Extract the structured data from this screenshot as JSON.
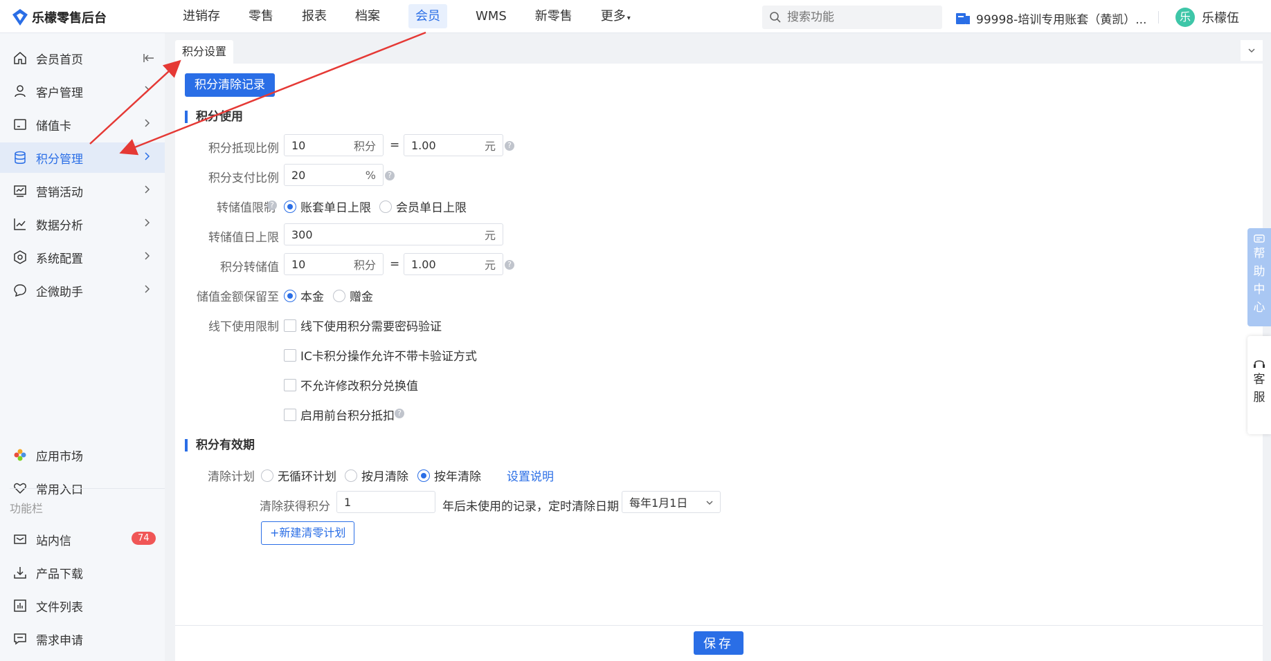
{
  "app": {
    "title": "乐檬零售后台"
  },
  "topnav": {
    "items": [
      "进销存",
      "零售",
      "报表",
      "档案",
      "会员",
      "WMS",
      "新零售",
      "更多"
    ],
    "search_placeholder": "搜索功能",
    "account": "99998-培训专用账套（黄凯）...",
    "user_avatar": "乐",
    "user_name": "乐檬伍"
  },
  "sidebar": {
    "items": [
      {
        "label": "会员首页"
      },
      {
        "label": "客户管理"
      },
      {
        "label": "储值卡"
      },
      {
        "label": "积分管理"
      },
      {
        "label": "营销活动"
      },
      {
        "label": "数据分析"
      },
      {
        "label": "系统配置"
      },
      {
        "label": "企微助手"
      }
    ],
    "extra": [
      {
        "label": "应用市场"
      },
      {
        "label": "常用入口"
      }
    ],
    "group_title": "功能栏",
    "tools": [
      {
        "label": "站内信",
        "badge": "74"
      },
      {
        "label": "产品下载"
      },
      {
        "label": "文件列表"
      },
      {
        "label": "需求申请"
      }
    ]
  },
  "tab": {
    "label": "积分设置"
  },
  "main": {
    "clear_record_btn": "积分清除记录",
    "section_use": "积分使用",
    "rows": {
      "cash_ratio": {
        "label": "积分抵现比例",
        "points": "10",
        "points_unit": "积分",
        "eq": "=",
        "yuan": "1.00",
        "yuan_unit": "元"
      },
      "pay_ratio": {
        "label": "积分支付比例",
        "value": "20",
        "unit": "%"
      },
      "transfer_limit": {
        "label": "转储值限制",
        "opt1": "账套单日上限",
        "opt2": "会员单日上限"
      },
      "daily_limit": {
        "label": "转储值日上限",
        "value": "300",
        "unit": "元"
      },
      "transfer_value": {
        "label": "积分转储值",
        "points": "10",
        "points_unit": "积分",
        "eq": "=",
        "yuan": "1.00",
        "yuan_unit": "元"
      },
      "keep_to": {
        "label": "储值金额保留至",
        "opt1": "本金",
        "opt2": "赠金"
      },
      "offline": {
        "label": "线下使用限制",
        "checks": [
          "线下使用积分需要密码验证",
          "IC卡积分操作允许不带卡验证方式",
          "不允许修改积分兑换值",
          "启用前台积分抵扣"
        ]
      }
    },
    "section_expire": "积分有效期",
    "plan": {
      "label": "清除计划",
      "opt1": "无循环计划",
      "opt2": "按月清除",
      "opt3": "按年清除",
      "help_link": "设置说明",
      "clear_prefix": "清除获得积分",
      "years": "1",
      "clear_suffix": "年后未使用的记录，定时清除日期",
      "date": "每年1月1日",
      "add_btn": "+新建清零计划"
    },
    "save": "保存"
  },
  "float": {
    "help": [
      "帮",
      "助",
      "中",
      "心"
    ],
    "cs": [
      "客",
      "服"
    ]
  },
  "colors": {
    "accent": "#2a6ee6",
    "annotation": "#e53935"
  }
}
